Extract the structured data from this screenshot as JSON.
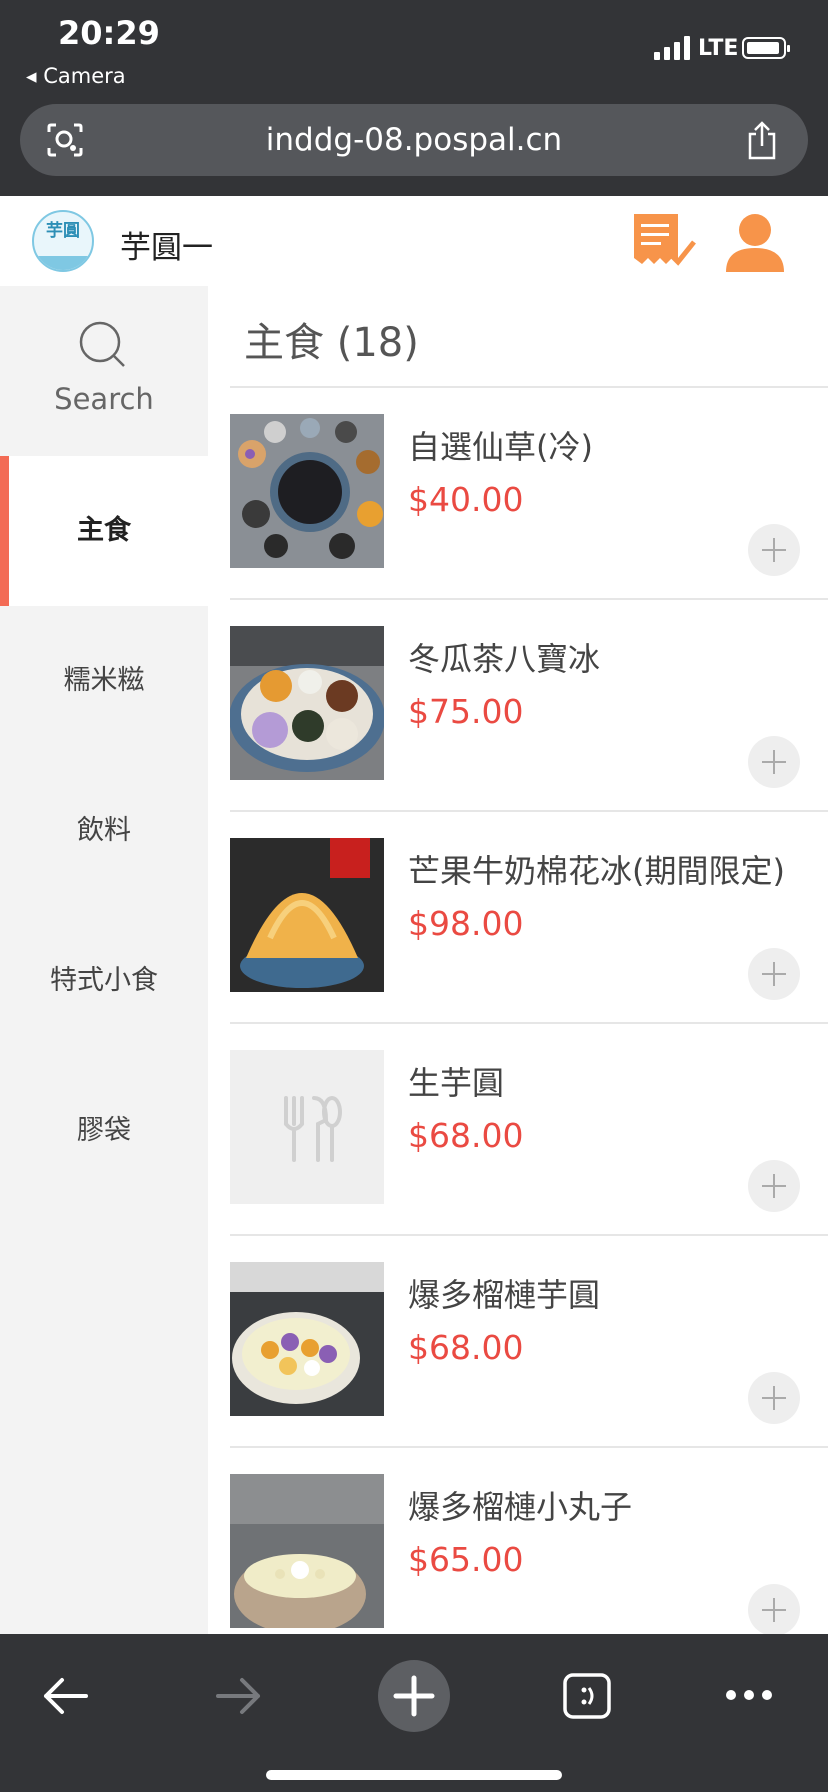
{
  "status_bar": {
    "time": "20:29",
    "back_app": "◂ Camera",
    "network": "LTE"
  },
  "browser": {
    "url": "inddg-08.pospal.cn"
  },
  "header": {
    "logo_text": "芋圓",
    "shop_name": "芋圓一",
    "accent_color": "#f7944a"
  },
  "sidebar": {
    "search_label": "Search",
    "categories": [
      {
        "label": "主食",
        "active": true
      },
      {
        "label": "糯米糍",
        "active": false
      },
      {
        "label": "飲料",
        "active": false
      },
      {
        "label": "特式小食",
        "active": false
      },
      {
        "label": "膠袋",
        "active": false
      }
    ]
  },
  "main": {
    "category_title": "主食 (18)",
    "items": [
      {
        "name": "自選仙草(冷)",
        "price": "$40.00",
        "image": "grass-jelly-photo"
      },
      {
        "name": "冬瓜茶八寶冰",
        "price": "$75.00",
        "image": "shaved-ice-photo"
      },
      {
        "name": "芒果牛奶棉花冰(期間限定)",
        "price": "$98.00",
        "image": "mango-snow-ice-photo"
      },
      {
        "name": "生芋圓",
        "price": "$68.00",
        "image": "placeholder-cutlery"
      },
      {
        "name": "爆多榴槤芋圓",
        "price": "$68.00",
        "image": "durian-taro-ball-photo"
      },
      {
        "name": "爆多榴槤小丸子",
        "price": "$65.00",
        "image": "durian-small-ball-photo"
      }
    ],
    "price_color": "#ea4a42"
  },
  "icons": {
    "search": "search-icon",
    "orders": "orders-icon",
    "user": "user-icon",
    "add": "plus-icon",
    "back": "back-arrow-icon",
    "forward": "forward-arrow-icon",
    "new_tab": "plus-icon",
    "tabs": "tabs-icon",
    "more": "more-icon"
  }
}
